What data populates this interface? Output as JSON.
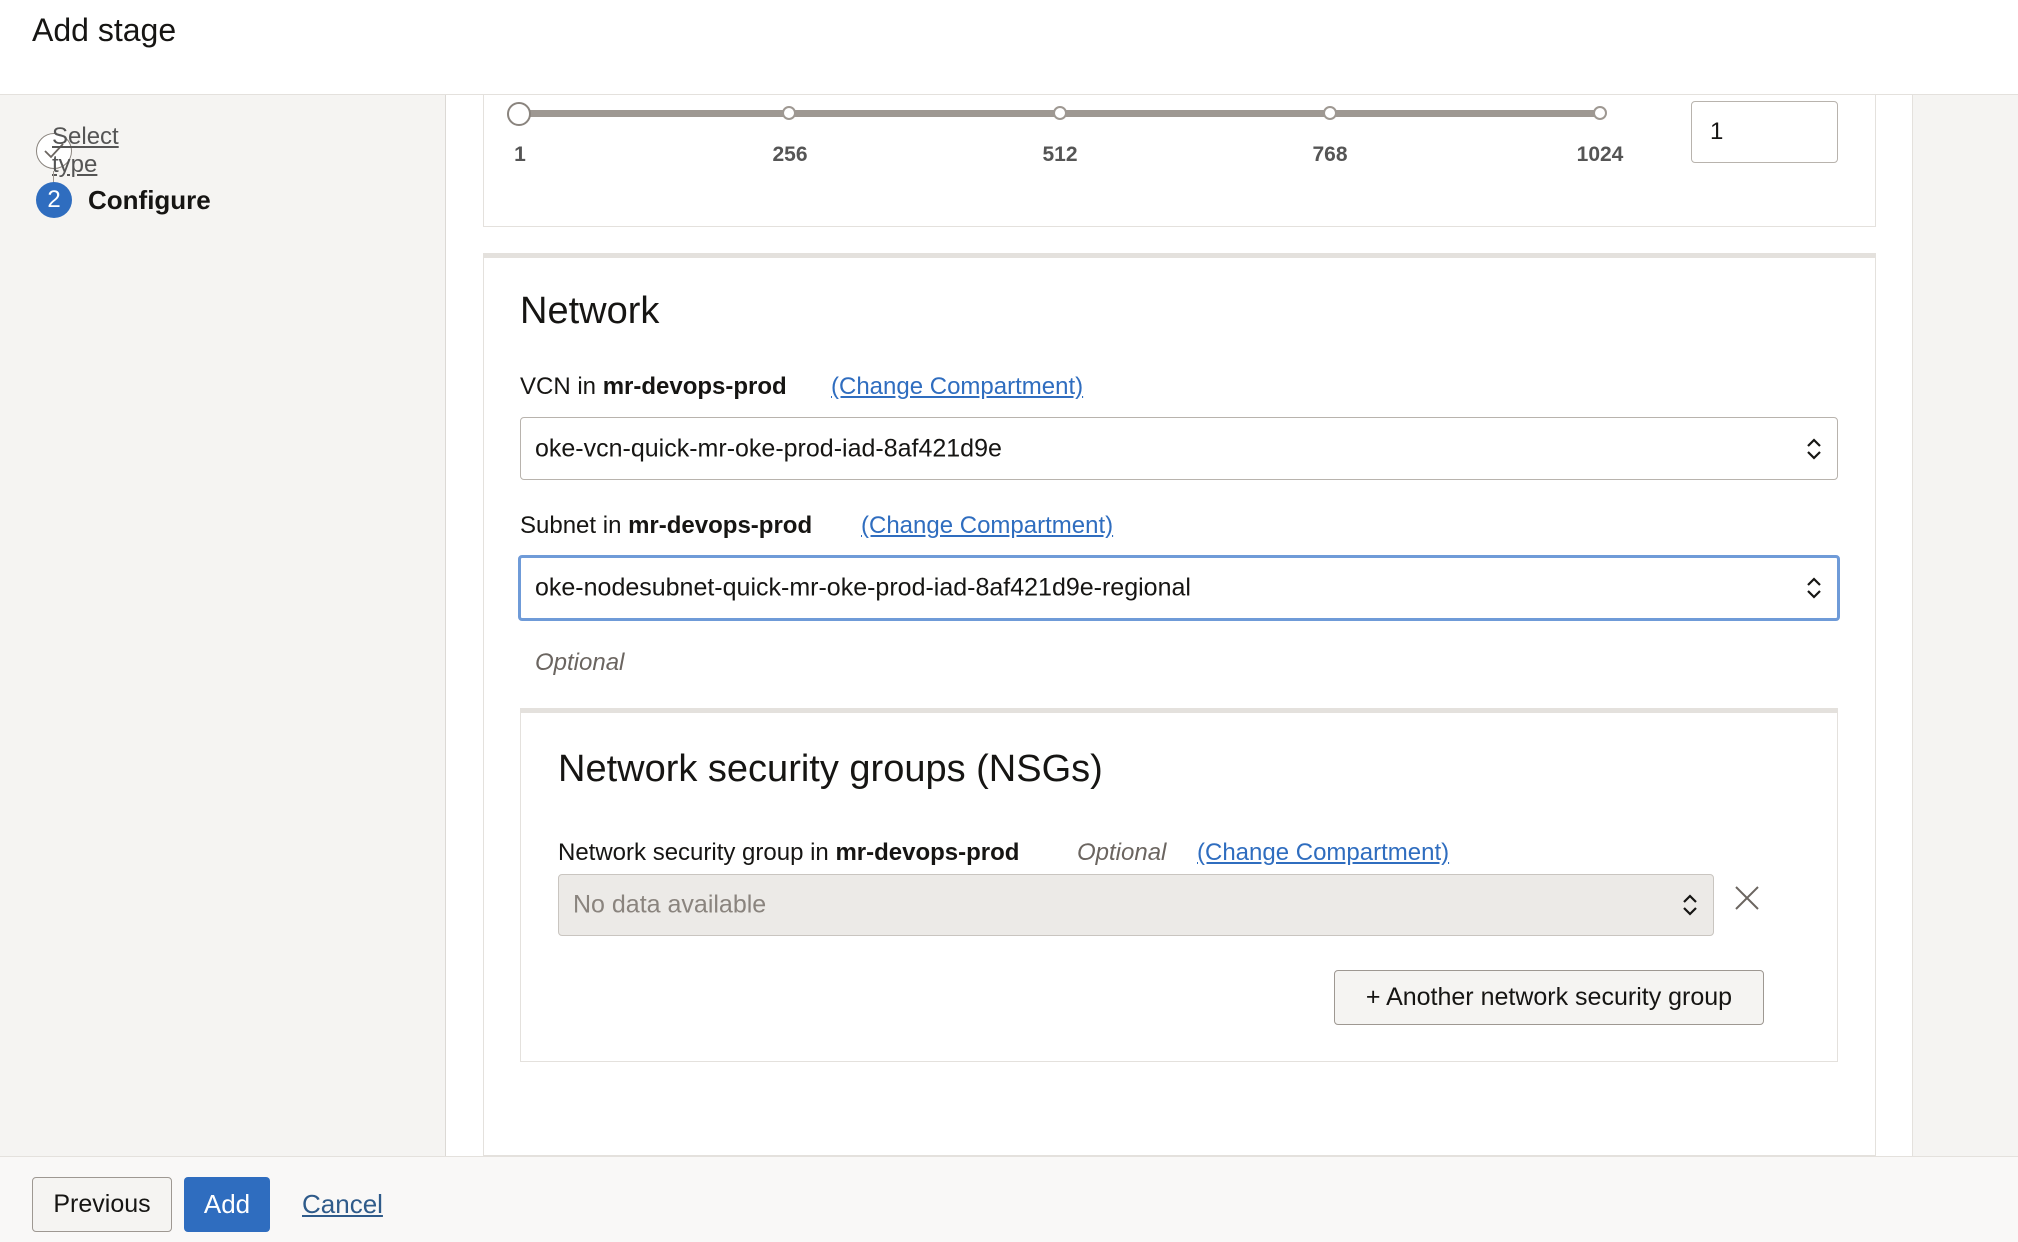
{
  "header": {
    "title": "Add stage"
  },
  "steps": [
    {
      "label": "Select type",
      "state": "done"
    },
    {
      "number": "2",
      "label": "Configure",
      "state": "current"
    }
  ],
  "slider": {
    "ticks": [
      "1",
      "256",
      "512",
      "768",
      "1024"
    ],
    "value": "1"
  },
  "network": {
    "title": "Network",
    "vcn": {
      "label_prefix": "VCN in",
      "compartment": "mr-devops-prod",
      "change_link": "(Change Compartment)",
      "value": "oke-vcn-quick-mr-oke-prod-iad-8af421d9e"
    },
    "subnet": {
      "label_prefix": "Subnet in",
      "compartment": "mr-devops-prod",
      "change_link": "(Change Compartment)",
      "value": "oke-nodesubnet-quick-mr-oke-prod-iad-8af421d9e-regional",
      "hint": "Optional"
    },
    "nsg": {
      "title": "Network security groups (NSGs)",
      "label_prefix": "Network security group in",
      "compartment": "mr-devops-prod",
      "optional": "Optional",
      "change_link": "(Change Compartment)",
      "placeholder": "No data available",
      "add_button": "+ Another network security group"
    }
  },
  "footer": {
    "previous": "Previous",
    "add": "Add",
    "cancel": "Cancel"
  },
  "colors": {
    "primary": "#2f6dbf",
    "link": "#2f6dbf",
    "focus_border": "#6f9bd8"
  }
}
